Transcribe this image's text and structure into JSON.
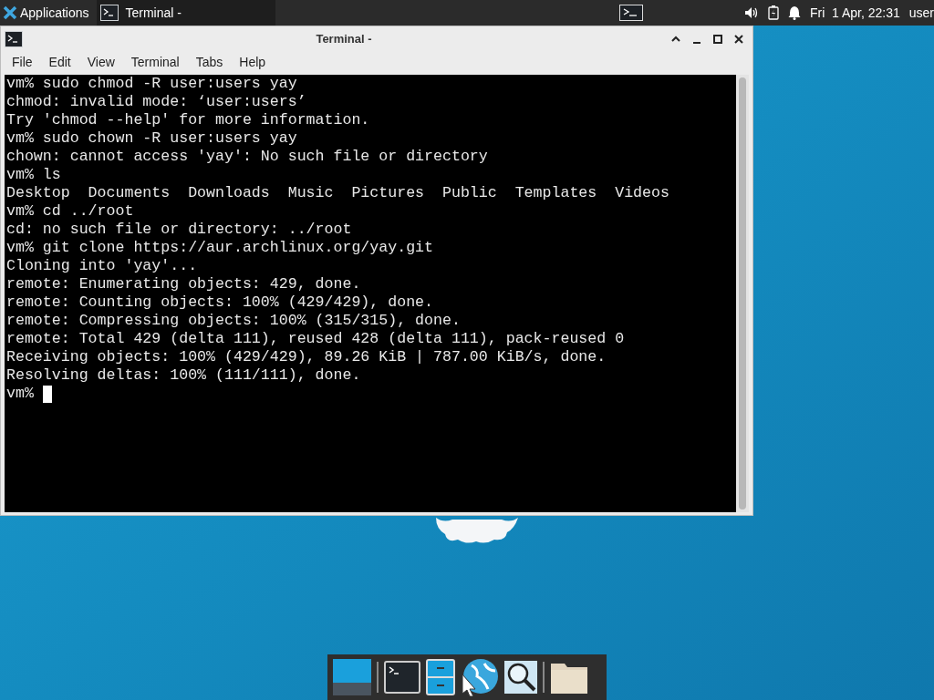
{
  "top_panel": {
    "applications": "Applications",
    "tasks": [
      {
        "title": "Terminal -",
        "selected": true
      }
    ],
    "clock": "Fri  1 Apr, 22:31",
    "user": "user"
  },
  "window": {
    "title": "Terminal -",
    "menu": [
      "File",
      "Edit",
      "View",
      "Terminal",
      "Tabs",
      "Help"
    ],
    "lines": [
      "vm% sudo chmod -R user:users yay",
      "chmod: invalid mode: ‘user:users’",
      "Try 'chmod --help' for more information.",
      "vm% sudo chown -R user:users yay",
      "chown: cannot access 'yay': No such file or directory",
      "vm% ls",
      "Desktop  Documents  Downloads  Music  Pictures  Public  Templates  Videos",
      "vm% cd ../root",
      "cd: no such file or directory: ../root",
      "vm% git clone https://aur.archlinux.org/yay.git",
      "Cloning into 'yay'...",
      "remote: Enumerating objects: 429, done.",
      "remote: Counting objects: 100% (429/429), done.",
      "remote: Compressing objects: 100% (315/315), done.",
      "remote: Total 429 (delta 111), reused 428 (delta 111), pack-reused 0",
      "Receiving objects: 100% (429/429), 89.26 KiB | 787.00 KiB/s, done.",
      "Resolving deltas: 100% (111/111), done."
    ],
    "prompt": "vm%"
  }
}
